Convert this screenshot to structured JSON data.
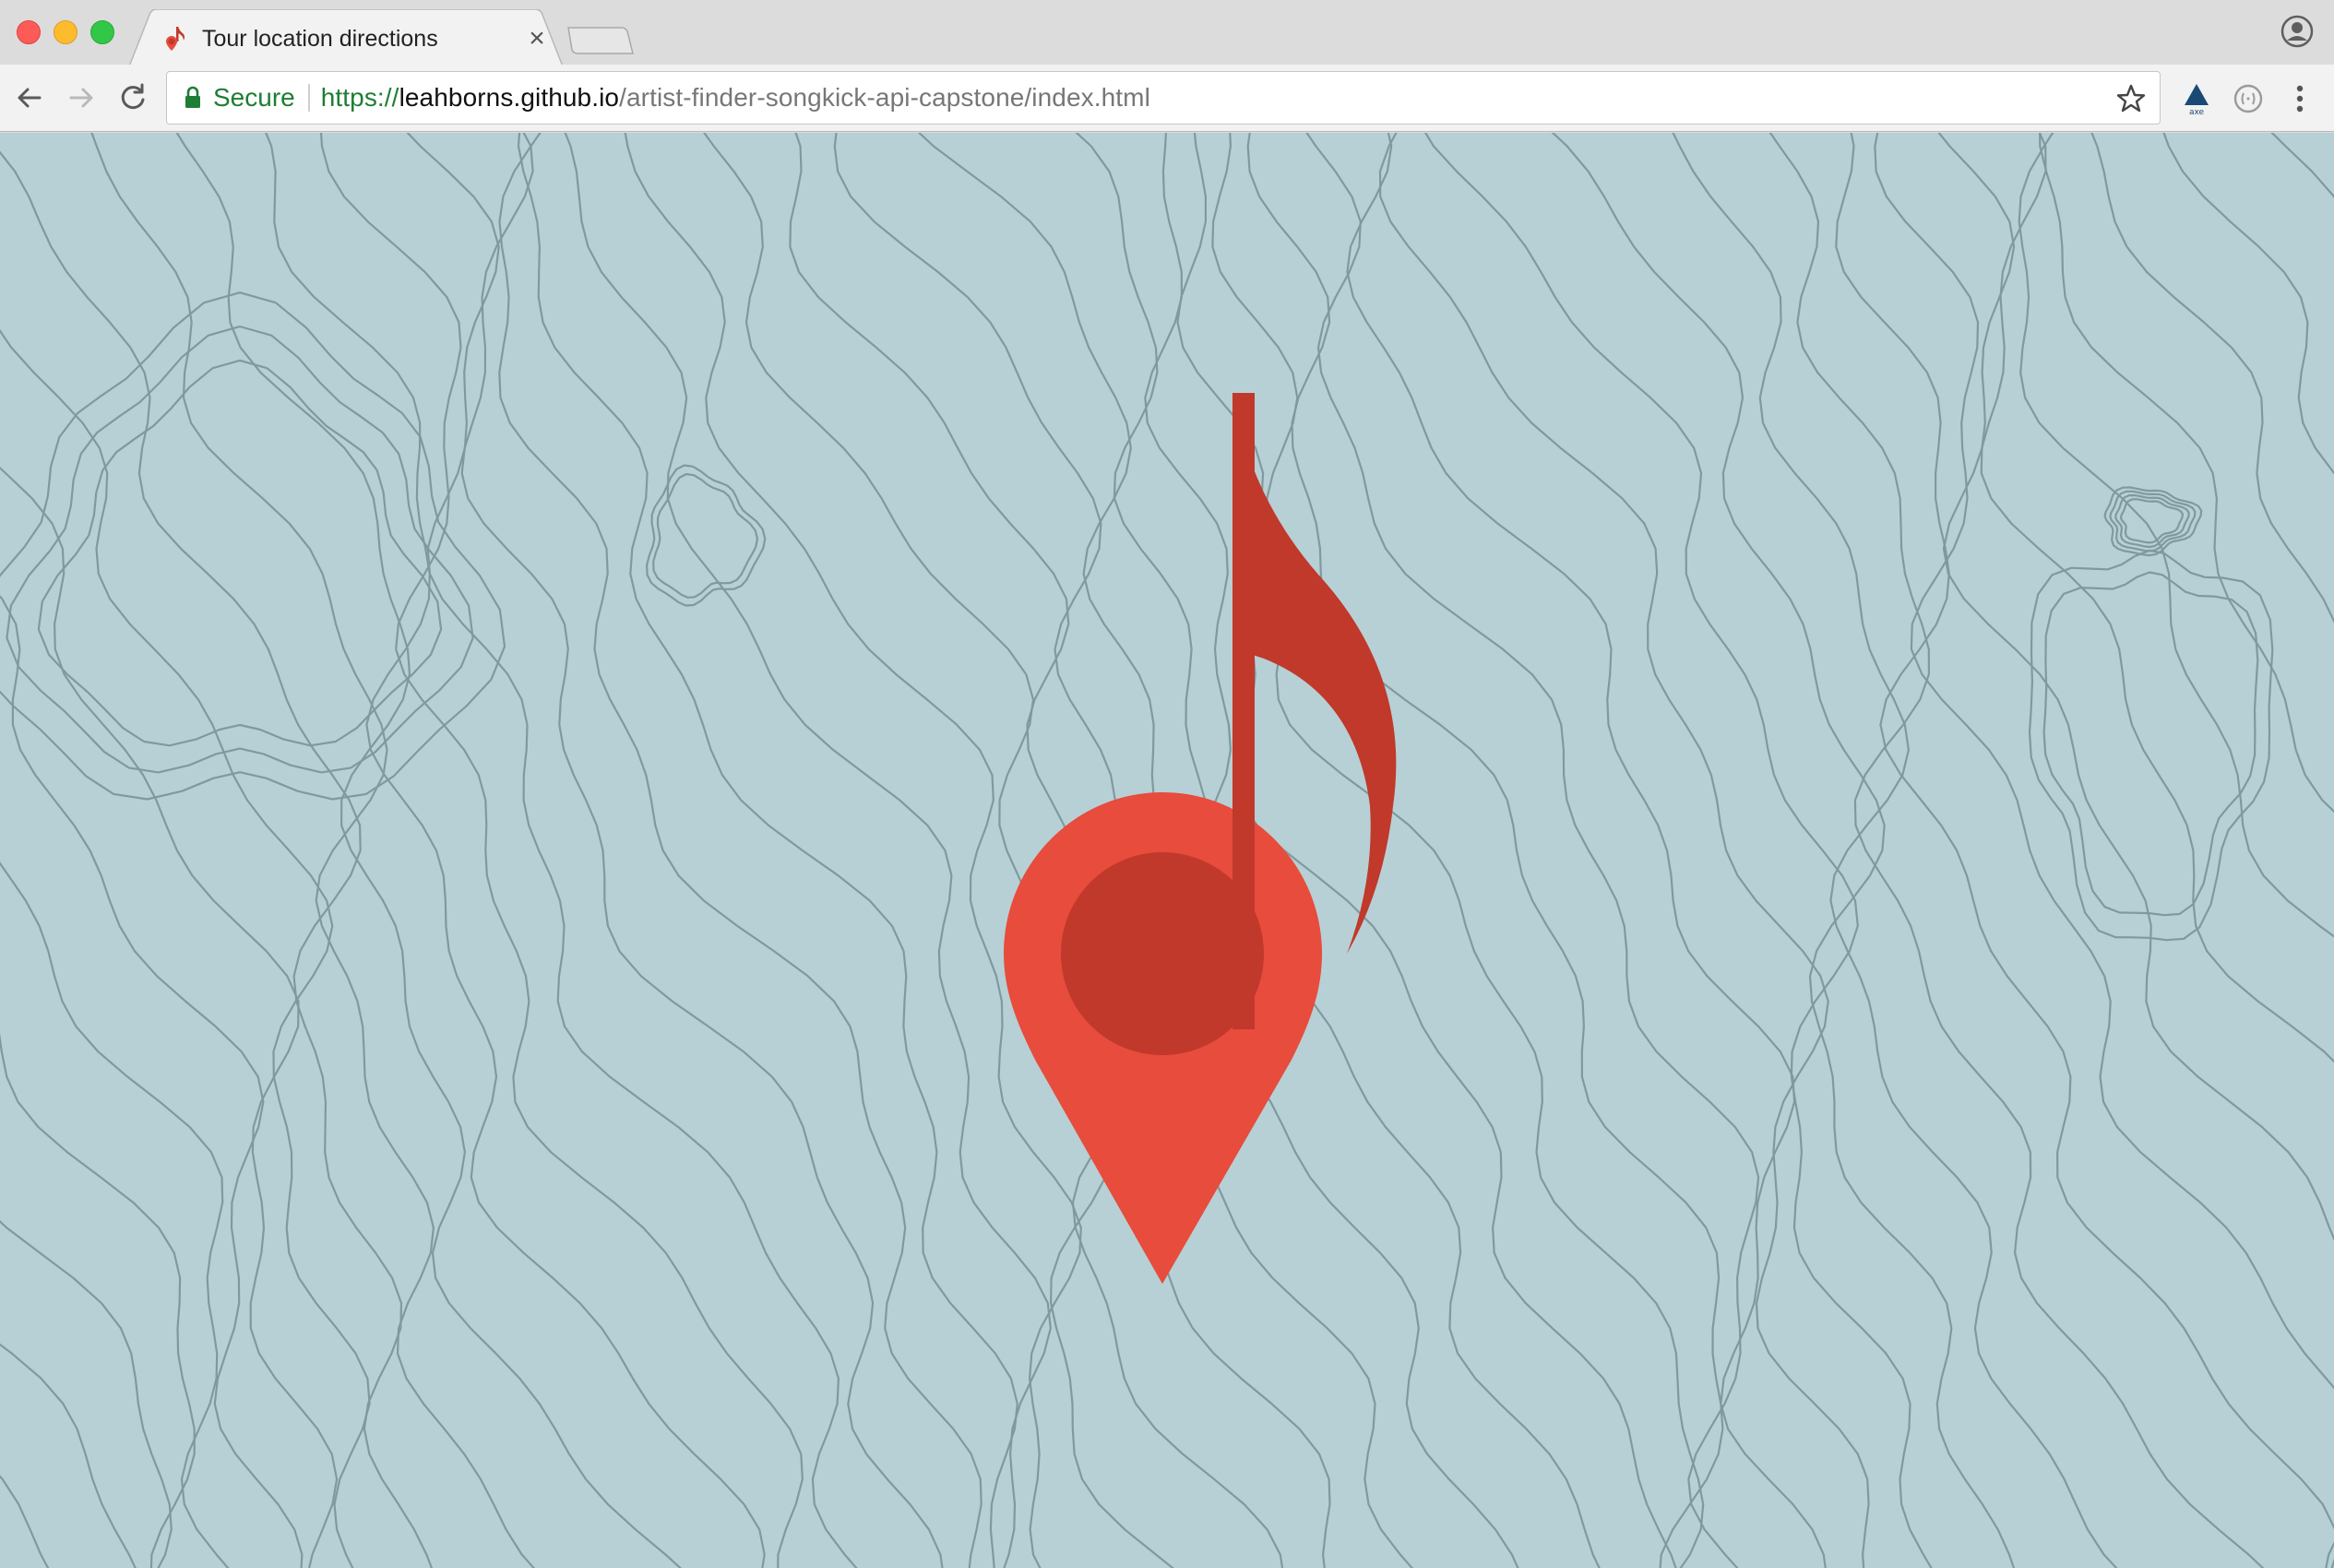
{
  "browser": {
    "tab": {
      "title": "Tour location directions",
      "close_glyph": "×",
      "favicon": "music-note-pin-icon"
    },
    "omnibox": {
      "secure_label": "Secure",
      "url_scheme": "https://",
      "url_host": "leahborns.github.io",
      "url_path": "/artist-finder-songkick-api-capstone/index.html"
    }
  },
  "page": {
    "background_color": "#b7d0d5",
    "contour_color": "#7f9a9e",
    "logo": {
      "icon": "map-pin-music-note-icon",
      "pin_color": "#e74c3c",
      "accent_color": "#c0392b"
    }
  }
}
